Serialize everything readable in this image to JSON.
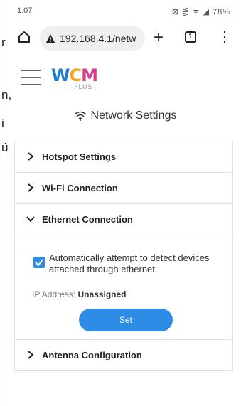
{
  "background_fragments": {
    "line1": "r",
    "line2": "n,",
    "line3": "i",
    "line4": "ú"
  },
  "status_bar": {
    "time": "1:07",
    "icons_text": "⊠ ⋚ ᯤ ◢ 78%",
    "battery_icon": "battery-icon"
  },
  "browser": {
    "url": "192.168.4.1/netw",
    "tab_count": "1",
    "home_icon": "home-icon",
    "warning_icon": "not-secure-warning-icon",
    "new_tab_icon": "plus-icon",
    "menu_icon": "kebab-menu-icon"
  },
  "app": {
    "logo_letters": {
      "w": "W",
      "c": "C",
      "m": "M",
      "plus": "PLUS"
    },
    "page_title": "Network Settings",
    "title_icon": "wifi-icon"
  },
  "sections": [
    {
      "label": "Hotspot Settings",
      "expanded": false
    },
    {
      "label": "Wi-Fi Connection",
      "expanded": false
    },
    {
      "label": "Ethernet Connection",
      "expanded": true
    },
    {
      "label": "Antenna Configuration",
      "expanded": false
    }
  ],
  "ethernet": {
    "checkbox_label": "Automatically attempt to detect devices attached through ethernet",
    "checkbox_checked": true,
    "ip_label": "IP Address:",
    "ip_value": "Unassigned",
    "set_button": "Set"
  },
  "colors": {
    "accent": "#2d8ce6",
    "logo_blue": "#1f7ad6",
    "logo_orange": "#f2a51a",
    "logo_magenta": "#d63b8f"
  }
}
